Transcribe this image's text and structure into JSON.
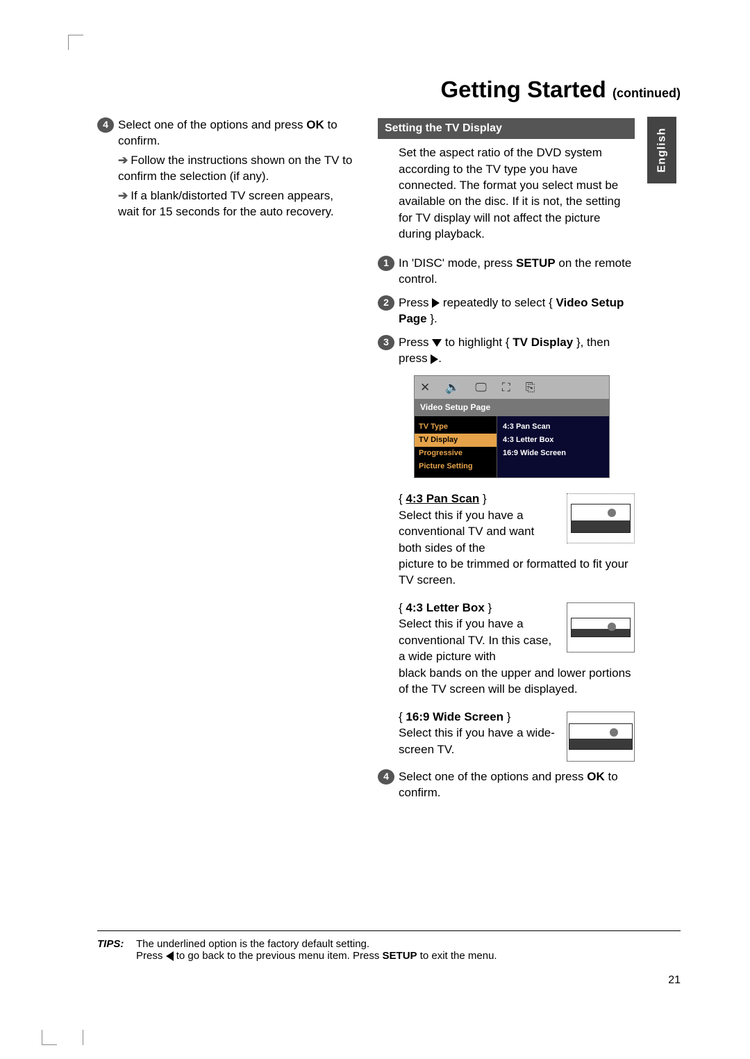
{
  "title": {
    "main": "Getting Started ",
    "continued": "(continued)"
  },
  "lang_tab": "English",
  "left": {
    "step4": {
      "num": "4",
      "text1": "Select one of the options and press ",
      "bold": "OK",
      "text2": " to confirm.",
      "sub1": "Follow the instructions shown on the TV to confirm the selection (if any).",
      "sub2": "If a blank/distorted TV screen appears, wait for 15 seconds for the auto recovery."
    }
  },
  "right": {
    "section_title": "Setting the TV Display",
    "intro": "Set the aspect ratio of the DVD system according to the TV type you have connected. The format you select must be available on the disc.  If it is not, the setting for TV display will not affect the picture during playback.",
    "step1": {
      "num": "1",
      "t1": "In 'DISC' mode, press ",
      "b1": "SETUP",
      "t2": " on the remote control."
    },
    "step2": {
      "num": "2",
      "t1": "Press ",
      "t2": " repeatedly to select { ",
      "b1": "Video Setup Page",
      "t3": " }."
    },
    "step3": {
      "num": "3",
      "t1": "Press ",
      "t2": " to highlight { ",
      "b1": "TV Display",
      "t3": " }, then press ",
      "t4": "."
    },
    "opts": [
      {
        "brace_l": "{ ",
        "title": "4:3 Pan Scan",
        "brace_r": " }",
        "desc1": "Select this if you have a conventional TV and want both sides of the",
        "desc2": "picture to be trimmed or formatted to fit your TV screen."
      },
      {
        "brace_l": "{ ",
        "title": "4:3 Letter Box",
        "brace_r": " }",
        "desc1": "Select this if you have a conventional TV.  In this case, a wide picture with",
        "desc2": "black bands on the upper and lower portions of the TV screen will be displayed."
      },
      {
        "brace_l": "{ ",
        "title": "16:9 Wide Screen",
        "brace_r": " }",
        "desc1": "Select this if you have a wide-screen TV.",
        "desc2": ""
      }
    ],
    "step4": {
      "num": "4",
      "t1": "Select one of the options and press ",
      "b1": "OK",
      "t2": " to confirm."
    }
  },
  "osd": {
    "title": "Video Setup Page",
    "left": [
      "TV Type",
      "TV Display",
      "Progressive",
      "Picture Setting"
    ],
    "right": [
      "4:3 Pan Scan",
      "4:3 Letter Box",
      "16:9 Wide Screen"
    ]
  },
  "tips": {
    "label": "TIPS:",
    "line1": "The underlined option is the factory default setting.",
    "line2a": "Press ",
    "line2b": " to go back to the previous menu item.  Press ",
    "line2bold": "SETUP",
    "line2c": " to exit the menu."
  },
  "page_number": "21"
}
